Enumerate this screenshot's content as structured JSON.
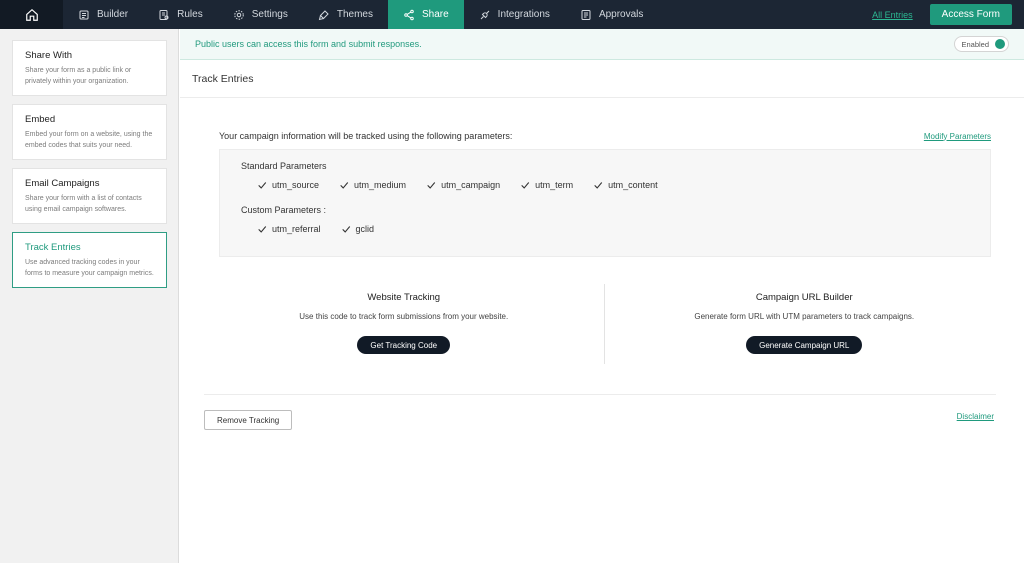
{
  "nav": {
    "items": [
      {
        "label": "Builder",
        "icon": "builder-icon"
      },
      {
        "label": "Rules",
        "icon": "rules-icon"
      },
      {
        "label": "Settings",
        "icon": "gear-icon"
      },
      {
        "label": "Themes",
        "icon": "brush-icon"
      },
      {
        "label": "Share",
        "icon": "share-icon",
        "active": true
      },
      {
        "label": "Integrations",
        "icon": "integrations-icon"
      },
      {
        "label": "Approvals",
        "icon": "approvals-icon"
      }
    ],
    "all_entries": "All Entries",
    "access_form": "Access Form"
  },
  "sidebar": {
    "cards": [
      {
        "title": "Share With",
        "desc": "Share your form as a public link or privately within your organization."
      },
      {
        "title": "Embed",
        "desc": "Embed your form on a website, using the embed codes that suits your need."
      },
      {
        "title": "Email Campaigns",
        "desc": "Share your form with a list of contacts using email campaign softwares."
      },
      {
        "title": "Track Entries",
        "desc": "Use advanced tracking codes in your forms to measure your campaign metrics.",
        "active": true
      }
    ]
  },
  "banner": {
    "text": "Public users can access this form and submit responses.",
    "toggle_label": "Enabled"
  },
  "page": {
    "title": "Track Entries",
    "intro": "Your campaign information will be tracked using the following parameters:",
    "modify_link": "Modify Parameters",
    "standard_heading": "Standard Parameters",
    "standard_params": [
      "utm_source",
      "utm_medium",
      "utm_campaign",
      "utm_term",
      "utm_content"
    ],
    "custom_heading": "Custom Parameters :",
    "custom_params": [
      "utm_referral",
      "gclid"
    ],
    "website_tracking": {
      "title": "Website Tracking",
      "desc": "Use this code to track form submissions from your website.",
      "button": "Get Tracking Code"
    },
    "campaign_builder": {
      "title": "Campaign URL Builder",
      "desc": "Generate form URL with UTM parameters to track campaigns.",
      "button": "Generate Campaign URL"
    },
    "remove_button": "Remove Tracking",
    "disclaimer": "Disclaimer"
  },
  "colors": {
    "topbar": "#1c2634",
    "accent": "#1f9a7d",
    "dark_button": "#111a26"
  }
}
